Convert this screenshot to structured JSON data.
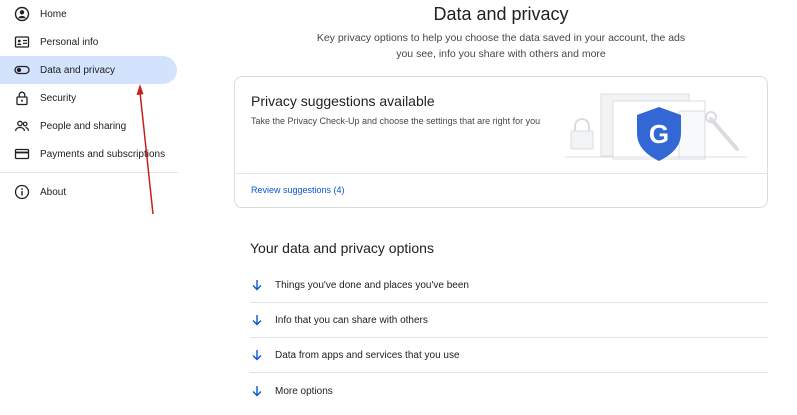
{
  "sidebar": {
    "items": [
      {
        "label": "Home",
        "icon": "account-circle-icon"
      },
      {
        "label": "Personal info",
        "icon": "id-card-icon"
      },
      {
        "label": "Data and privacy",
        "icon": "toggle-icon",
        "active": true
      },
      {
        "label": "Security",
        "icon": "lock-icon"
      },
      {
        "label": "People and sharing",
        "icon": "people-icon"
      },
      {
        "label": "Payments and subscriptions",
        "icon": "credit-card-icon"
      }
    ],
    "about": {
      "label": "About",
      "icon": "info-icon"
    }
  },
  "main": {
    "title": "Data and privacy",
    "description": "Key privacy options to help you choose the data saved in your account, the ads you see, info you share with others and more",
    "suggestion_card": {
      "title": "Privacy suggestions available",
      "body": "Take the Privacy Check-Up and choose the settings that are right for you",
      "link": "Review suggestions (4)",
      "badge_letter": "G"
    },
    "options_section": {
      "title": "Your data and privacy options",
      "options": [
        "Things you've done and places you've been",
        "Info that you can share with others",
        "Data from apps and services that you use",
        "More options"
      ]
    }
  },
  "colors": {
    "active_nav": "#d3e3fd",
    "link": "#0b57d0",
    "shield": "#3367d6",
    "annotation_arrow": "#c5221f"
  }
}
